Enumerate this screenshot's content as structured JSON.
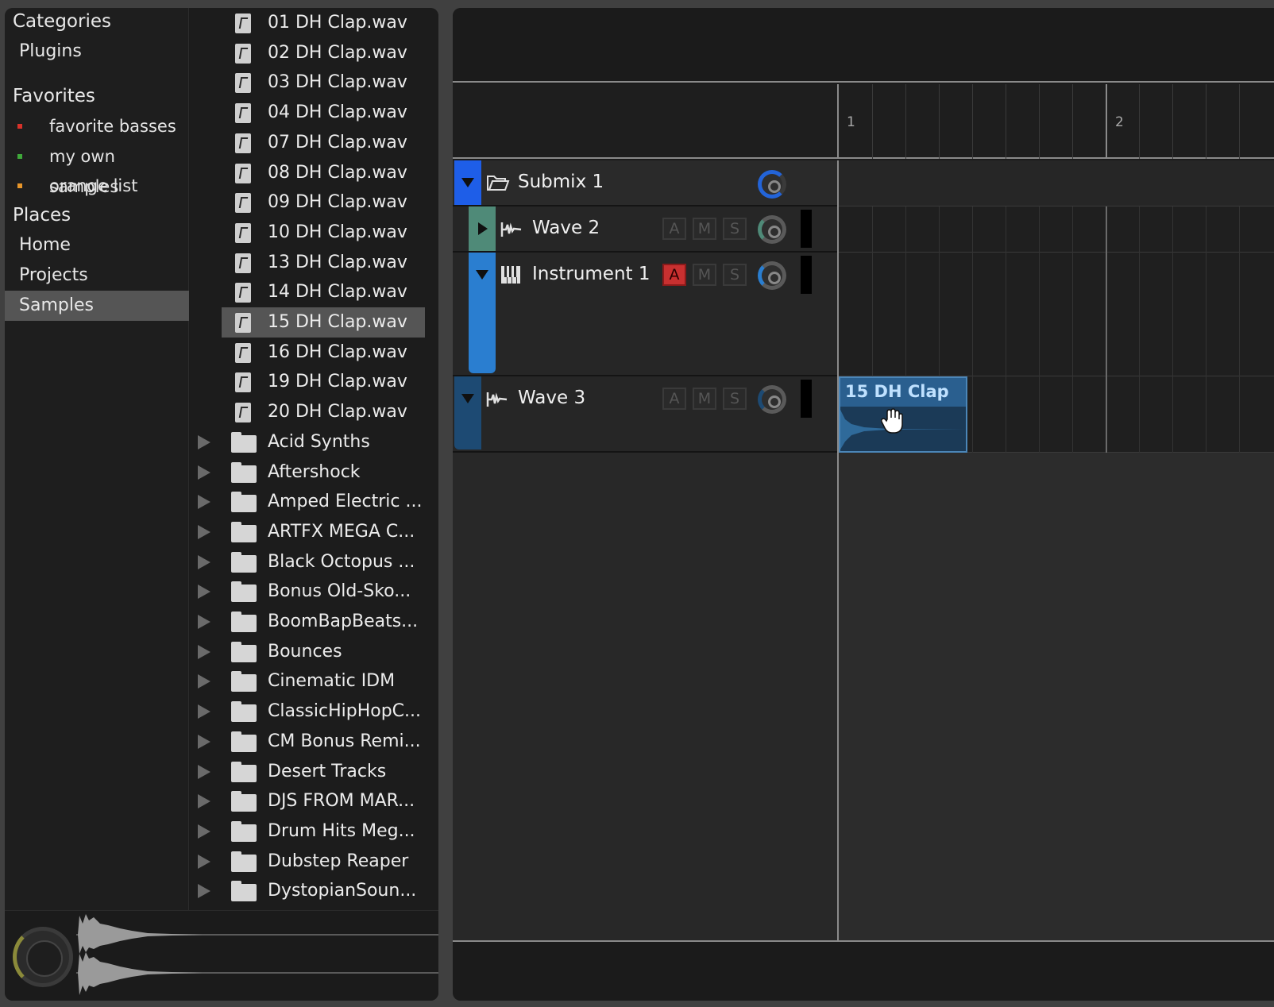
{
  "browser": {
    "categories_header": "Categories",
    "plugins": "Plugins",
    "favorites_header": "Favorites",
    "favorites": [
      {
        "label": "favorite basses",
        "color": "#d8322a"
      },
      {
        "label": "my own samples",
        "color": "#3fa83a"
      },
      {
        "label": "orange list",
        "color": "#e8962a"
      }
    ],
    "places_header": "Places",
    "places": [
      "Home",
      "Projects",
      "Samples"
    ],
    "selected_place": "Samples",
    "files": [
      "01 DH Clap.wav",
      "02 DH Clap.wav",
      "03 DH Clap.wav",
      "04 DH Clap.wav",
      "07 DH Clap.wav",
      "08 DH Clap.wav",
      "09 DH Clap.wav",
      "10 DH Clap.wav",
      "13 DH Clap.wav",
      "14 DH Clap.wav",
      "15 DH Clap.wav",
      "16 DH Clap.wav",
      "19 DH Clap.wav",
      "20 DH Clap.wav"
    ],
    "selected_file": "15 DH Clap.wav",
    "folders": [
      "Acid Synths",
      "Aftershock",
      "Amped Electric ...",
      "ARTFX MEGA C...",
      "Black Octopus ...",
      "Bonus Old-Sko...",
      "BoomBapBeats...",
      "Bounces",
      "Cinematic IDM",
      "ClassicHipHopC...",
      "CM Bonus Remi...",
      "Desert Tracks",
      "DJS FROM MAR...",
      "Drum Hits Meg...",
      "Dubstep Reaper",
      "DystopianSoun..."
    ]
  },
  "arranger": {
    "ruler": {
      "bar1": "1",
      "bar2": "2"
    },
    "tracks": [
      {
        "name": "Submix 1",
        "type": "group",
        "color": "#1e5ee8"
      },
      {
        "name": "Wave 2",
        "type": "audio",
        "color": "#4f8a78",
        "a": "A",
        "m": "M",
        "s": "S"
      },
      {
        "name": "Instrument 1",
        "type": "instrument",
        "color": "#2a7ed0",
        "a": "A",
        "m": "M",
        "s": "S",
        "armed": true
      },
      {
        "name": "Wave 3",
        "type": "audio",
        "color": "#1d4a73",
        "a": "A",
        "m": "M",
        "s": "S"
      }
    ],
    "clip": {
      "label": "15 DH Clap",
      "color": "#2a5f8f"
    }
  }
}
